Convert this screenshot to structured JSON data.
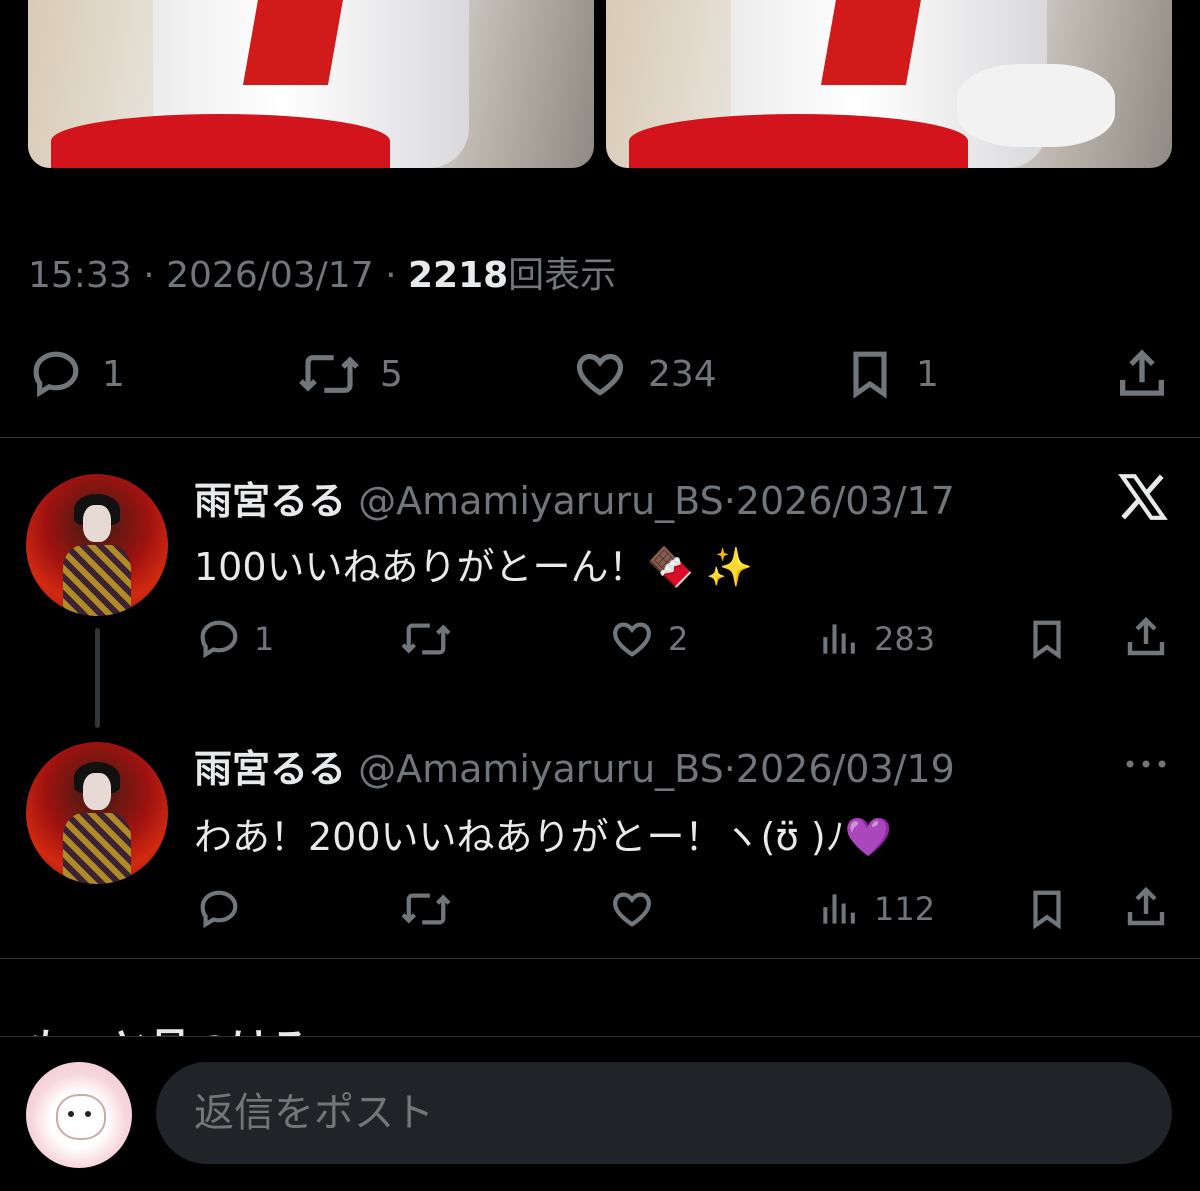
{
  "post": {
    "time": "15:33",
    "date": "2026/03/17",
    "sep": "·",
    "views_count": "2218",
    "views_label": "回表示",
    "actions": {
      "reply_count": "1",
      "repost_count": "5",
      "like_count": "234",
      "bookmark_count": "1"
    }
  },
  "replies": [
    {
      "name": "雨宮るる",
      "handle": "@Amamiyaruru_BS",
      "sep": "·",
      "date": "2026/03/17",
      "text": "100いいねありがとーん！🍫 ✨",
      "reply_count": "1",
      "repost_count": "",
      "like_count": "2",
      "views_count": "283",
      "corner_icon": "x-logo-icon"
    },
    {
      "name": "雨宮るる",
      "handle": "@Amamiyaruru_BS",
      "sep": "·",
      "date": "2026/03/19",
      "text": "わあ！200いいねありがとー！ヽ(ʊ̈ )ﾉ💜",
      "reply_count": "",
      "repost_count": "",
      "like_count": "",
      "views_count": "112",
      "corner_icon": "more-icon"
    }
  ],
  "section_heading_partial": "もっと見つける",
  "composer": {
    "placeholder": "返信をポスト"
  }
}
